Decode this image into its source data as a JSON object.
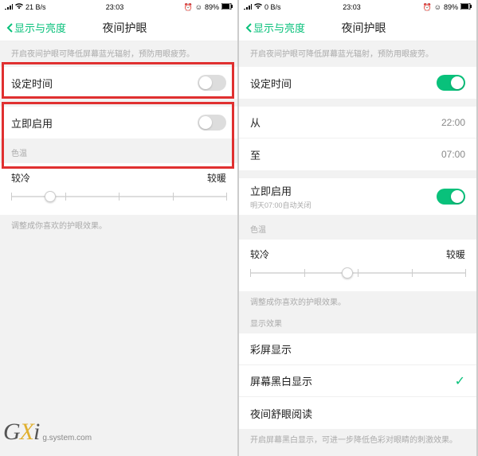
{
  "status": {
    "net": "21 B/s",
    "nr": "0 B/s",
    "time": "23:03",
    "batt": "89%",
    "alarm": "⏰"
  },
  "header": {
    "back": "显示与亮度",
    "title": "夜间护眼"
  },
  "desc": "开启夜间护眼可降低屏幕蓝光辐射，预防用眼疲劳。",
  "left": {
    "schedule": "设定时间",
    "now": "立即启用",
    "temp": "色温",
    "cold": "较冷",
    "warm": "较暖",
    "hint": "调整成你喜欢的护眼效果。"
  },
  "right": {
    "schedule": "设定时间",
    "from": "从",
    "fromVal": "22:00",
    "to": "至",
    "toVal": "07:00",
    "now": "立即启用",
    "nowSub": "明天07:00自动关闭",
    "temp": "色温",
    "cold": "较冷",
    "warm": "较暖",
    "hint": "调整成你喜欢的护眼效果。",
    "display": "显示效果",
    "color": "彩屏显示",
    "bw": "屏幕黑白显示",
    "read": "夜间舒眼阅读",
    "foot": "开启屏幕黑白显示，可进一步降低色彩对眼睛的刺激效果。"
  },
  "brand": {
    "logo": "GXi",
    "domain": "g.system.com"
  }
}
